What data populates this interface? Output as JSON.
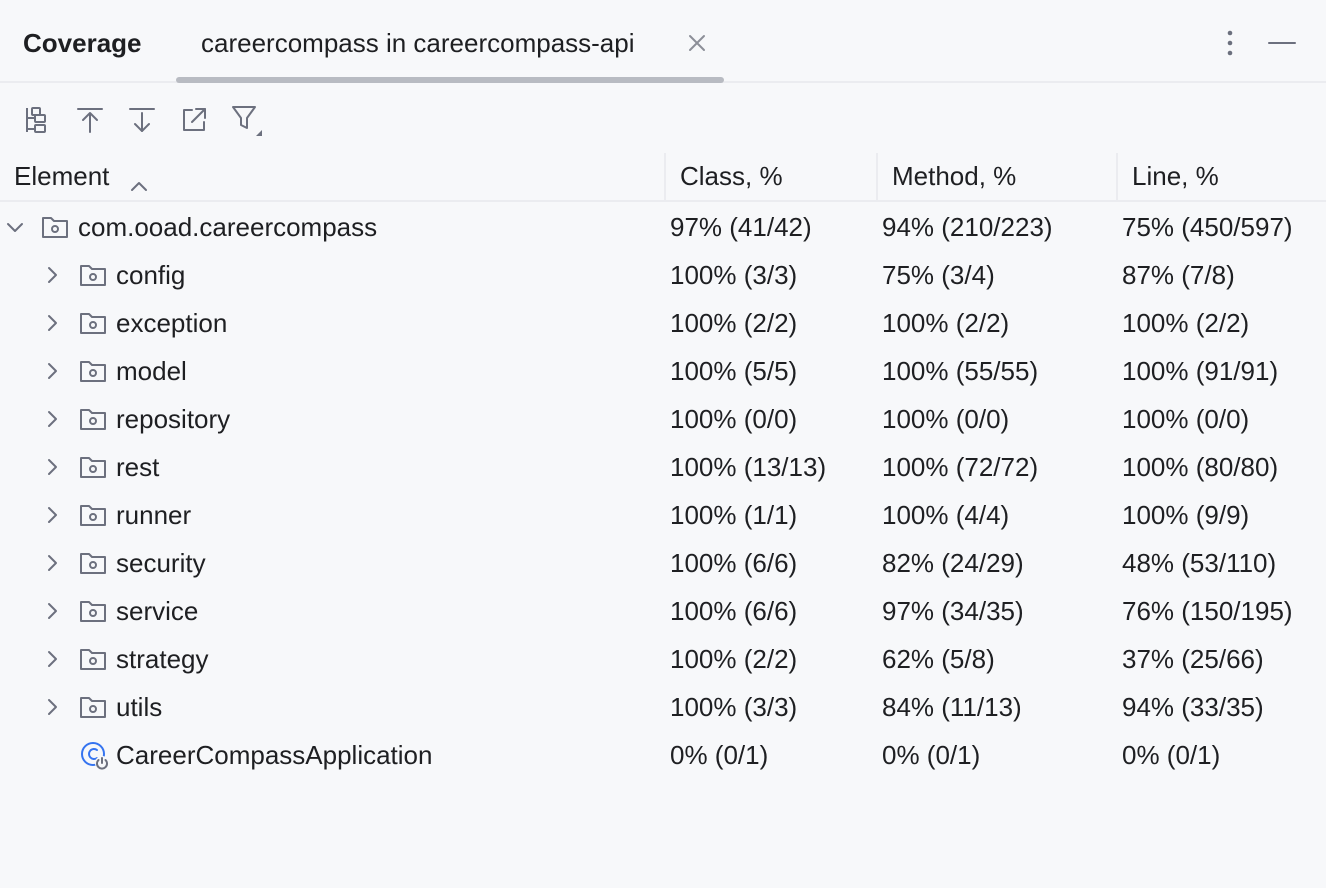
{
  "header": {
    "title": "Coverage",
    "tab_label": "careercompass in careercompass-api"
  },
  "toolbar": {
    "buttons": [
      "flatten-packages-icon",
      "collapse-all-icon",
      "expand-all-icon",
      "export-icon",
      "filter-icon"
    ]
  },
  "table": {
    "columns": [
      "Element",
      "Class, %",
      "Method, %",
      "Line, %"
    ],
    "sort_column": "Element",
    "sort_direction": "ascending",
    "root": {
      "name": "com.ooad.careercompass",
      "class": "97% (41/42)",
      "method": "94% (210/223)",
      "line": "75% (450/597)"
    },
    "packages": [
      {
        "name": "config",
        "class": "100% (3/3)",
        "method": "75% (3/4)",
        "line": "87% (7/8)"
      },
      {
        "name": "exception",
        "class": "100% (2/2)",
        "method": "100% (2/2)",
        "line": "100% (2/2)"
      },
      {
        "name": "model",
        "class": "100% (5/5)",
        "method": "100% (55/55)",
        "line": "100% (91/91)"
      },
      {
        "name": "repository",
        "class": "100% (0/0)",
        "method": "100% (0/0)",
        "line": "100% (0/0)"
      },
      {
        "name": "rest",
        "class": "100% (13/13)",
        "method": "100% (72/72)",
        "line": "100% (80/80)"
      },
      {
        "name": "runner",
        "class": "100% (1/1)",
        "method": "100% (4/4)",
        "line": "100% (9/9)"
      },
      {
        "name": "security",
        "class": "100% (6/6)",
        "method": "82% (24/29)",
        "line": "48% (53/110)"
      },
      {
        "name": "service",
        "class": "100% (6/6)",
        "method": "97% (34/35)",
        "line": "76% (150/195)"
      },
      {
        "name": "strategy",
        "class": "100% (2/2)",
        "method": "62% (5/8)",
        "line": "37% (25/66)"
      },
      {
        "name": "utils",
        "class": "100% (3/3)",
        "method": "84% (11/13)",
        "line": "94% (33/35)"
      }
    ],
    "app_class": {
      "name": "CareerCompassApplication",
      "class": "0% (0/1)",
      "method": "0% (0/1)",
      "line": "0% (0/1)"
    }
  },
  "colors": {
    "background": "#f7f8fa",
    "text": "#1e1f22",
    "icon": "#6c707e",
    "class_icon": "#3574f0",
    "divider": "#ebecf0",
    "tab_underline": "#b8bbc2"
  }
}
